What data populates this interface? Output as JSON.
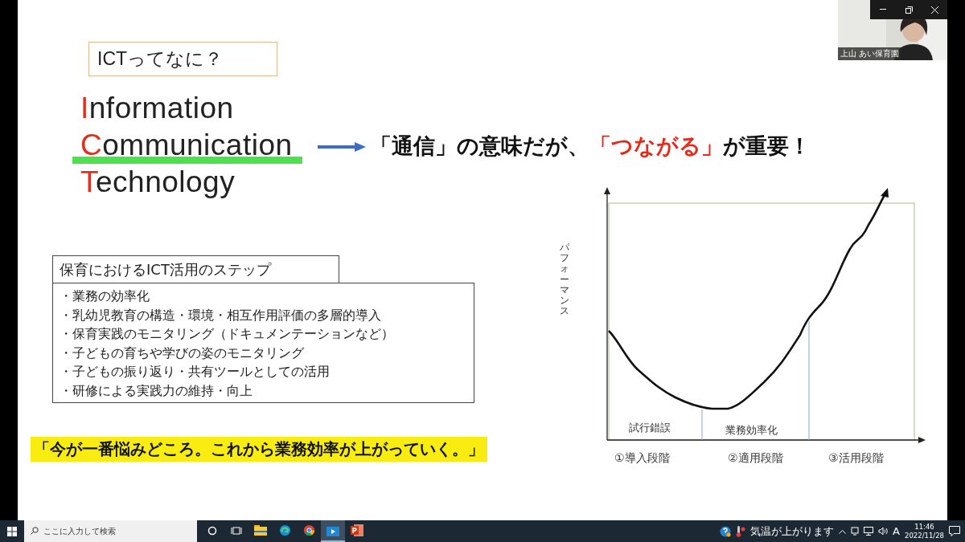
{
  "video": {
    "name": "上山 あい保育園"
  },
  "slide": {
    "title_box": "ICTってなに？",
    "acronym": [
      {
        "initial": "I",
        "rest": "nformation",
        "highlighted": false
      },
      {
        "initial": "C",
        "rest": "ommunication",
        "highlighted": true
      },
      {
        "initial": "T",
        "rest": "echnology",
        "highlighted": false
      }
    ],
    "headline": [
      {
        "text": "「通信」の意味だが、",
        "emphasis": false
      },
      {
        "text": "「つながる」",
        "emphasis": true
      },
      {
        "text": "が重要！",
        "emphasis": false
      }
    ],
    "steps": {
      "title": "保育におけるICT活用のステップ",
      "items": [
        "・業務の効率化",
        "・乳幼児教育の構造・環境・相互作用評価の多層的導入",
        "・保育実践のモニタリング（ドキュメンテーションなど）",
        "・子どもの育ちや学びの姿のモニタリング",
        "・子どもの振り返り・共有ツールとしての活用",
        "・研修による実践力の維持・向上"
      ]
    },
    "quote": "「今が一番悩みどころ。これから業務効率が上がっていく。」",
    "diagram": {
      "ylabel": "パフォーマンス",
      "phases": [
        "試行錯誤",
        "業務効率化"
      ],
      "stages": [
        "①導入段階",
        "②適用段階",
        "③活用段階"
      ]
    }
  },
  "taskbar": {
    "search": {
      "placeholder": "ここに入力して検索"
    },
    "apps": [
      {
        "kind": "cortana",
        "selected": false
      },
      {
        "kind": "taskview",
        "selected": false
      },
      {
        "kind": "explorer",
        "selected": false
      },
      {
        "kind": "edge",
        "selected": false
      },
      {
        "kind": "chrome",
        "selected": false
      },
      {
        "kind": "media",
        "selected": true
      },
      {
        "kind": "powerpoint",
        "selected": false
      }
    ],
    "weather": "気温が上がります",
    "ime": "A",
    "time": "11:46",
    "date": "2022/11/28"
  }
}
